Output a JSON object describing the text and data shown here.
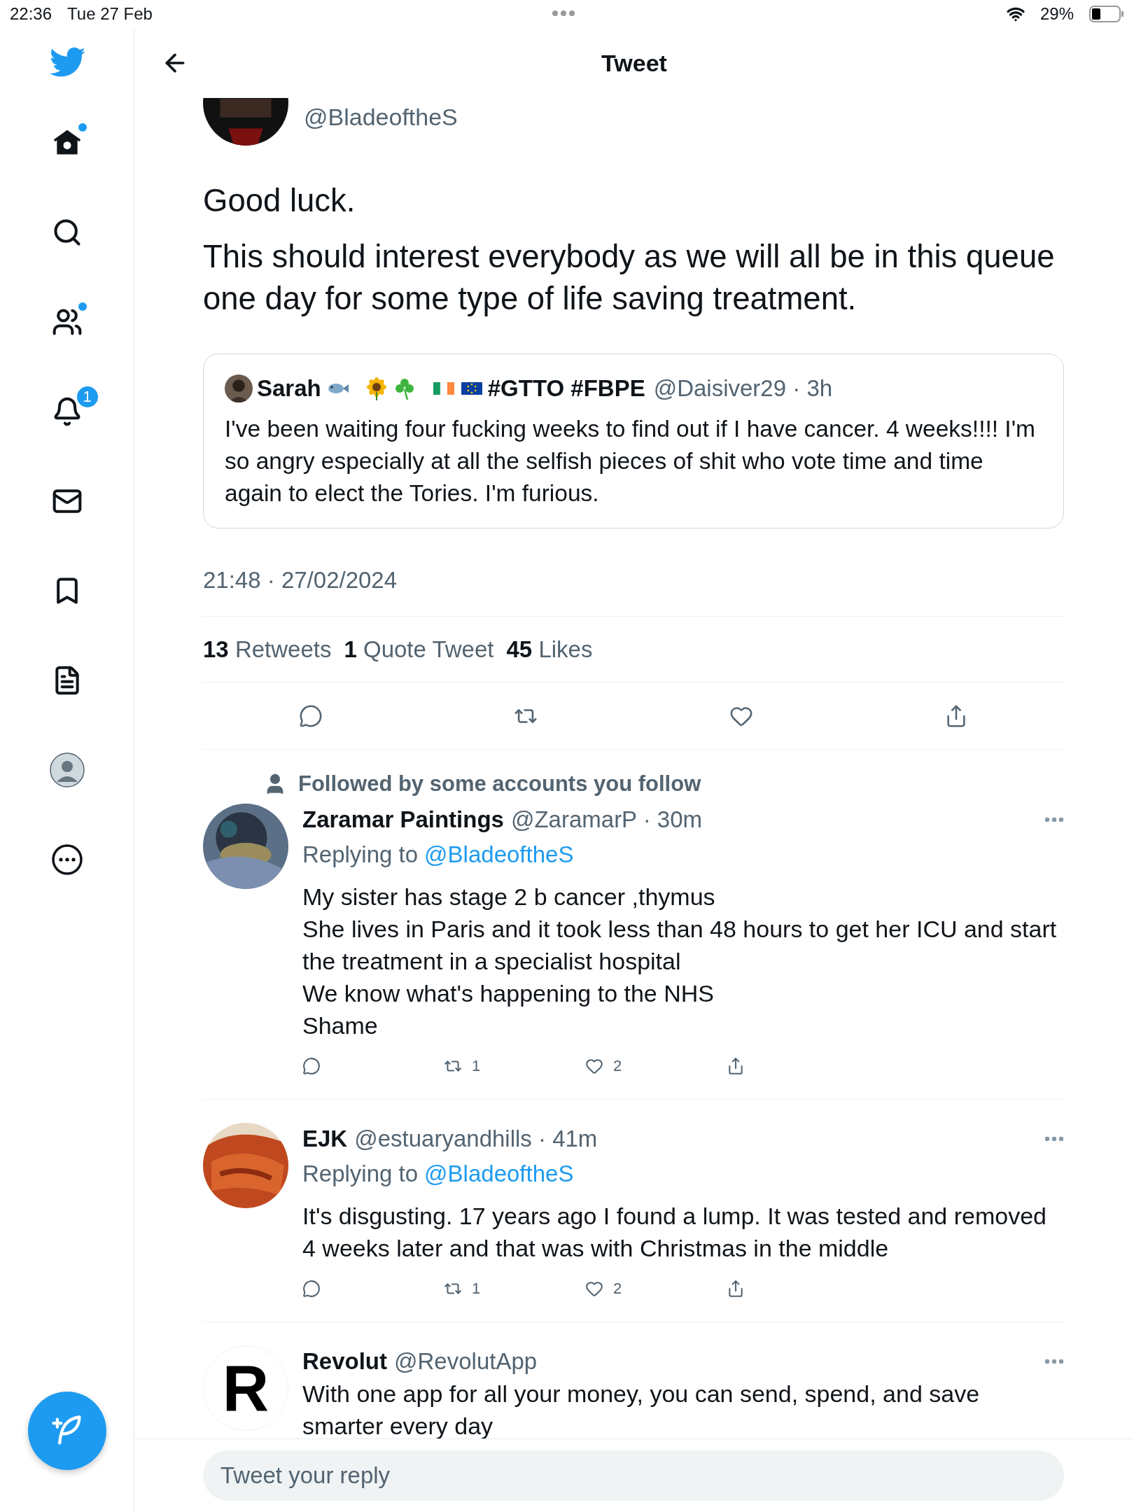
{
  "status_bar": {
    "time": "22:36",
    "date": "Tue 27 Feb",
    "battery": "29%"
  },
  "sidebar": {
    "items": [
      {
        "kind": "home",
        "dot": true
      },
      {
        "kind": "search",
        "dot": false
      },
      {
        "kind": "people",
        "dot": true
      },
      {
        "kind": "notifications",
        "dot": false,
        "badge": "1"
      },
      {
        "kind": "messages",
        "dot": false
      },
      {
        "kind": "bookmarks",
        "dot": false
      },
      {
        "kind": "lists",
        "dot": false
      },
      {
        "kind": "profile",
        "dot": false
      },
      {
        "kind": "more",
        "dot": false
      }
    ]
  },
  "header": {
    "title": "Tweet"
  },
  "tweet": {
    "handle": "@BladeoftheS",
    "paragraphs": [
      "Good luck.",
      "This should interest everybody as we will all be in this queue one day for some type of life saving treatment."
    ],
    "quoted": {
      "name": "Sarah",
      "hashtags": "#GTTO #FBPE",
      "meta": "@Daisiver29 · 3h",
      "text": "I've been waiting four fucking weeks to find out if I have cancer. 4 weeks!!!! I'm so angry especially at all the selfish pieces of shit who vote time and time again to elect the Tories. I'm furious."
    },
    "timestamp": "21:48 · 27/02/2024",
    "stats": [
      "**13** Retweets",
      "**1** Quote Tweet",
      "**45** Likes"
    ]
  },
  "replies": [
    {
      "kind": "reply",
      "social_context": "Followed by some accounts you follow",
      "name": "Zaramar Paintings",
      "meta": "@ZaramarP · 30m",
      "replying_label": "Replying to",
      "replying_to": "@BladeoftheS",
      "lines": [
        "My sister has stage 2 b cancer ,thymus",
        "She lives in Paris and it took less than 48 hours to get her ICU and start the treatment in a specialist hospital",
        "We know what's happening to the NHS",
        "Shame"
      ],
      "retweets": "1",
      "likes": "2"
    },
    {
      "kind": "reply",
      "name": "EJK",
      "meta": "@estuaryandhills · 41m",
      "replying_label": "Replying to",
      "replying_to": "@BladeoftheS",
      "lines": [
        "It's disgusting. 17 years ago I found a lump. It was tested and removed 4 weeks later and that was with Christmas in the middle"
      ],
      "retweets": "1",
      "likes": "2"
    },
    {
      "kind": "ad",
      "name": "Revolut",
      "meta": "@RevolutApp",
      "logo": "R",
      "lines": [
        "With one app for all your money, you can send, spend, and save smarter every day"
      ]
    }
  ],
  "reply_box": {
    "placeholder": "Tweet your reply"
  }
}
